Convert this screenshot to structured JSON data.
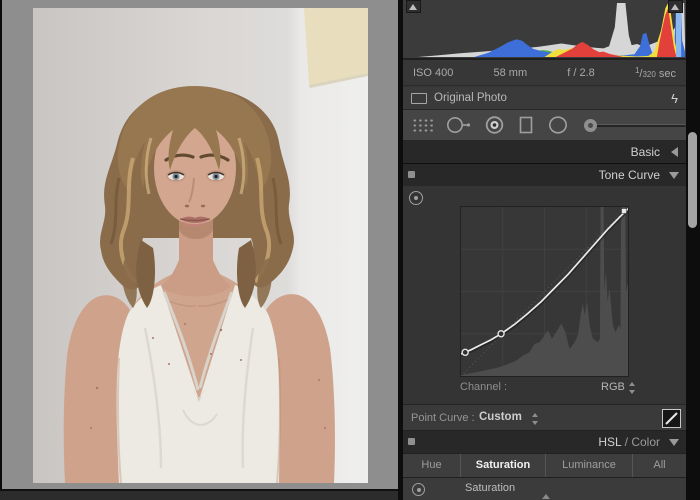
{
  "colors": {
    "canvas_bg": "#8e8e8e",
    "panel_bg": "#353535",
    "header_bg": "#282828",
    "curve_line": "#ebebeb",
    "curve_hist_fill": "#4d4d4d"
  },
  "exif": {
    "iso": "ISO 400",
    "focal_length": "58 mm",
    "aperture": "f / 2.8",
    "shutter_numerator": "1",
    "shutter_slash": "/",
    "shutter_denominator": "320",
    "shutter_unit": "sec"
  },
  "original_photo": {
    "label": "Original Photo"
  },
  "toolstrip": {
    "tools": [
      "crop-overlay",
      "spot-removal",
      "red-eye",
      "graduated-filter",
      "radial-filter",
      "adjustment-brush"
    ]
  },
  "panels": {
    "basic": {
      "label": "Basic"
    },
    "tone_curve": {
      "label": "Tone Curve",
      "channel_label": "Channel :",
      "channel_value": "RGB",
      "point_curve_label": "Point Curve :",
      "point_curve_value": "Custom"
    },
    "hsl": {
      "title_hsl": "HSL",
      "title_divider": " / ",
      "title_color": "Color",
      "tabs": [
        "Hue",
        "Saturation",
        "Luminance",
        "All"
      ],
      "active_tab": "Saturation",
      "target_row_label": "Saturation"
    }
  },
  "chart_data": [
    {
      "type": "area",
      "title": "RGB Histogram",
      "xlim": [
        0,
        1
      ],
      "ylim": [
        0,
        1
      ],
      "grid": false,
      "series": [
        {
          "name": "gray",
          "color": "#d6d6d6",
          "points": [
            [
              0.05,
              0
            ],
            [
              0.12,
              0.03
            ],
            [
              0.2,
              0.07
            ],
            [
              0.28,
              0.1
            ],
            [
              0.35,
              0.13
            ],
            [
              0.42,
              0.16
            ],
            [
              0.48,
              0.19
            ],
            [
              0.52,
              0.22
            ],
            [
              0.56,
              0.25
            ],
            [
              0.6,
              0.22
            ],
            [
              0.65,
              0.19
            ],
            [
              0.68,
              0.17
            ],
            [
              0.71,
              0.16
            ],
            [
              0.73,
              0.2
            ],
            [
              0.75,
              0.55
            ],
            [
              0.758,
              1
            ],
            [
              0.788,
              1
            ],
            [
              0.8,
              0.4
            ],
            [
              0.81,
              0.22
            ],
            [
              0.83,
              0.24
            ],
            [
              0.85,
              0.2
            ],
            [
              0.87,
              0.22
            ],
            [
              0.89,
              0.26
            ],
            [
              0.91,
              0.3
            ],
            [
              0.93,
              0.36
            ],
            [
              0.95,
              0.44
            ],
            [
              0.965,
              0.55
            ],
            [
              0.975,
              0.7
            ],
            [
              0.985,
              0.9
            ],
            [
              0.99,
              1
            ],
            [
              0.997,
              1
            ],
            [
              1,
              0.3
            ],
            [
              1,
              0
            ]
          ]
        },
        {
          "name": "cyan",
          "color": "#41d2c5",
          "points": [
            [
              0.3,
              0
            ],
            [
              0.36,
              0.05
            ],
            [
              0.4,
              0.1
            ],
            [
              0.44,
              0.12
            ],
            [
              0.48,
              0.1
            ],
            [
              0.51,
              0.07
            ],
            [
              0.54,
              0.04
            ],
            [
              0.58,
              0.02
            ],
            [
              0.62,
              0
            ]
          ]
        },
        {
          "name": "green",
          "color": "#4db84f",
          "points": [
            [
              0.44,
              0
            ],
            [
              0.47,
              0.08
            ],
            [
              0.49,
              0.13
            ],
            [
              0.51,
              0.12
            ],
            [
              0.54,
              0.08
            ],
            [
              0.57,
              0.05
            ],
            [
              0.61,
              0.03
            ],
            [
              0.66,
              0.02
            ],
            [
              0.71,
              0
            ]
          ]
        },
        {
          "name": "blue",
          "color": "#3e6fd9",
          "points": [
            [
              0.25,
              0
            ],
            [
              0.3,
              0.08
            ],
            [
              0.34,
              0.18
            ],
            [
              0.37,
              0.27
            ],
            [
              0.4,
              0.33
            ],
            [
              0.42,
              0.3
            ],
            [
              0.44,
              0.22
            ],
            [
              0.46,
              0.15
            ],
            [
              0.49,
              0.11
            ],
            [
              0.53,
              0.08
            ],
            [
              0.58,
              0.06
            ],
            [
              0.63,
              0.05
            ],
            [
              0.68,
              0.04
            ],
            [
              0.73,
              0.03
            ],
            [
              0.78,
              0.03
            ],
            [
              0.82,
              0.05
            ],
            [
              0.84,
              0.2
            ],
            [
              0.85,
              0.42
            ],
            [
              0.862,
              0.45
            ],
            [
              0.875,
              0.2
            ],
            [
              0.885,
              0.06
            ],
            [
              0.91,
              0.04
            ],
            [
              0.95,
              0.05
            ],
            [
              0.963,
              0.3
            ],
            [
              0.968,
              1
            ],
            [
              0.985,
              1
            ],
            [
              0.99,
              0.3
            ],
            [
              1,
              0.1
            ],
            [
              1,
              0
            ]
          ]
        },
        {
          "name": "yellow",
          "color": "#f0de3e",
          "points": [
            [
              0.5,
              0
            ],
            [
              0.53,
              0.1
            ],
            [
              0.55,
              0.15
            ],
            [
              0.57,
              0.13
            ],
            [
              0.59,
              0.16
            ],
            [
              0.62,
              0.13
            ],
            [
              0.64,
              0.09
            ],
            [
              0.67,
              0.07
            ],
            [
              0.7,
              0.08
            ],
            [
              0.72,
              0.05
            ],
            [
              0.75,
              0.03
            ],
            [
              0.79,
              0.02
            ],
            [
              0.83,
              0.01
            ],
            [
              0.87,
              0.02
            ],
            [
              0.89,
              0.1
            ],
            [
              0.9,
              0.25
            ],
            [
              0.915,
              0.5
            ],
            [
              0.93,
              0.9
            ],
            [
              0.94,
              1
            ],
            [
              0.95,
              0.8
            ],
            [
              0.958,
              0.5
            ],
            [
              0.965,
              0.25
            ],
            [
              0.972,
              0.1
            ],
            [
              0.98,
              0
            ]
          ]
        },
        {
          "name": "red",
          "color": "#e2413b",
          "points": [
            [
              0.54,
              0
            ],
            [
              0.57,
              0.08
            ],
            [
              0.6,
              0.16
            ],
            [
              0.62,
              0.24
            ],
            [
              0.635,
              0.28
            ],
            [
              0.655,
              0.22
            ],
            [
              0.675,
              0.14
            ],
            [
              0.695,
              0.09
            ],
            [
              0.71,
              0.1
            ],
            [
              0.73,
              0.06
            ],
            [
              0.755,
              0.03
            ],
            [
              0.78,
              0
            ],
            [
              0.9,
              0
            ],
            [
              0.91,
              0.3
            ],
            [
              0.92,
              0.55
            ],
            [
              0.93,
              0.78
            ],
            [
              0.94,
              0.9
            ],
            [
              0.946,
              0.7
            ],
            [
              0.953,
              0.45
            ],
            [
              0.96,
              0.2
            ],
            [
              0.967,
              0.05
            ],
            [
              0.973,
              0
            ]
          ]
        },
        {
          "name": "lightblue",
          "color": "#8ab8ef",
          "points": [
            [
              0.968,
              0
            ],
            [
              0.968,
              1
            ],
            [
              0.986,
              1
            ],
            [
              0.986,
              0
            ]
          ]
        }
      ]
    },
    {
      "type": "line",
      "title": "Tone Curve",
      "xlim": [
        0,
        1
      ],
      "ylim": [
        0,
        1
      ],
      "grid": true,
      "histogram": [
        [
          0,
          0
        ],
        [
          0.02,
          0.01
        ],
        [
          0.08,
          0.02
        ],
        [
          0.15,
          0.035
        ],
        [
          0.22,
          0.05
        ],
        [
          0.28,
          0.07
        ],
        [
          0.33,
          0.09
        ],
        [
          0.37,
          0.12
        ],
        [
          0.41,
          0.14
        ],
        [
          0.44,
          0.19
        ],
        [
          0.47,
          0.2
        ],
        [
          0.5,
          0.24
        ],
        [
          0.52,
          0.27
        ],
        [
          0.545,
          0.22
        ],
        [
          0.57,
          0.26
        ],
        [
          0.6,
          0.31
        ],
        [
          0.625,
          0.26
        ],
        [
          0.65,
          0.16
        ],
        [
          0.68,
          0.2
        ],
        [
          0.7,
          0.24
        ],
        [
          0.72,
          0.38
        ],
        [
          0.73,
          0.43
        ],
        [
          0.74,
          0.36
        ],
        [
          0.755,
          0.44
        ],
        [
          0.77,
          0.3
        ],
        [
          0.79,
          0.22
        ],
        [
          0.82,
          0.2
        ],
        [
          0.832,
          0.22
        ],
        [
          0.836,
          1
        ],
        [
          0.854,
          1
        ],
        [
          0.858,
          0.5
        ],
        [
          0.868,
          0.62
        ],
        [
          0.878,
          0.44
        ],
        [
          0.89,
          0.52
        ],
        [
          0.9,
          0.4
        ],
        [
          0.91,
          0.3
        ],
        [
          0.925,
          0.26
        ],
        [
          0.945,
          0.3
        ],
        [
          0.955,
          0.28
        ],
        [
          0.958,
          0.9
        ],
        [
          0.962,
          1
        ],
        [
          0.984,
          1
        ],
        [
          0.988,
          0.5
        ],
        [
          1,
          0.55
        ],
        [
          1,
          0
        ]
      ],
      "curve_points": [
        [
          0,
          0.13
        ],
        [
          0.06,
          0.155
        ],
        [
          0.12,
          0.185
        ],
        [
          0.18,
          0.215
        ],
        [
          0.24,
          0.25
        ],
        [
          0.32,
          0.305
        ],
        [
          0.4,
          0.37
        ],
        [
          0.48,
          0.44
        ],
        [
          0.56,
          0.52
        ],
        [
          0.64,
          0.6
        ],
        [
          0.72,
          0.69
        ],
        [
          0.8,
          0.78
        ],
        [
          0.88,
          0.87
        ],
        [
          0.94,
          0.93
        ],
        [
          1,
          0.99
        ]
      ],
      "markers": [
        {
          "shape": "circle",
          "x": 0.025,
          "y": 0.14
        },
        {
          "shape": "circle",
          "x": 0.24,
          "y": 0.25
        },
        {
          "shape": "square",
          "x": 0.985,
          "y": 0.985
        }
      ]
    }
  ]
}
